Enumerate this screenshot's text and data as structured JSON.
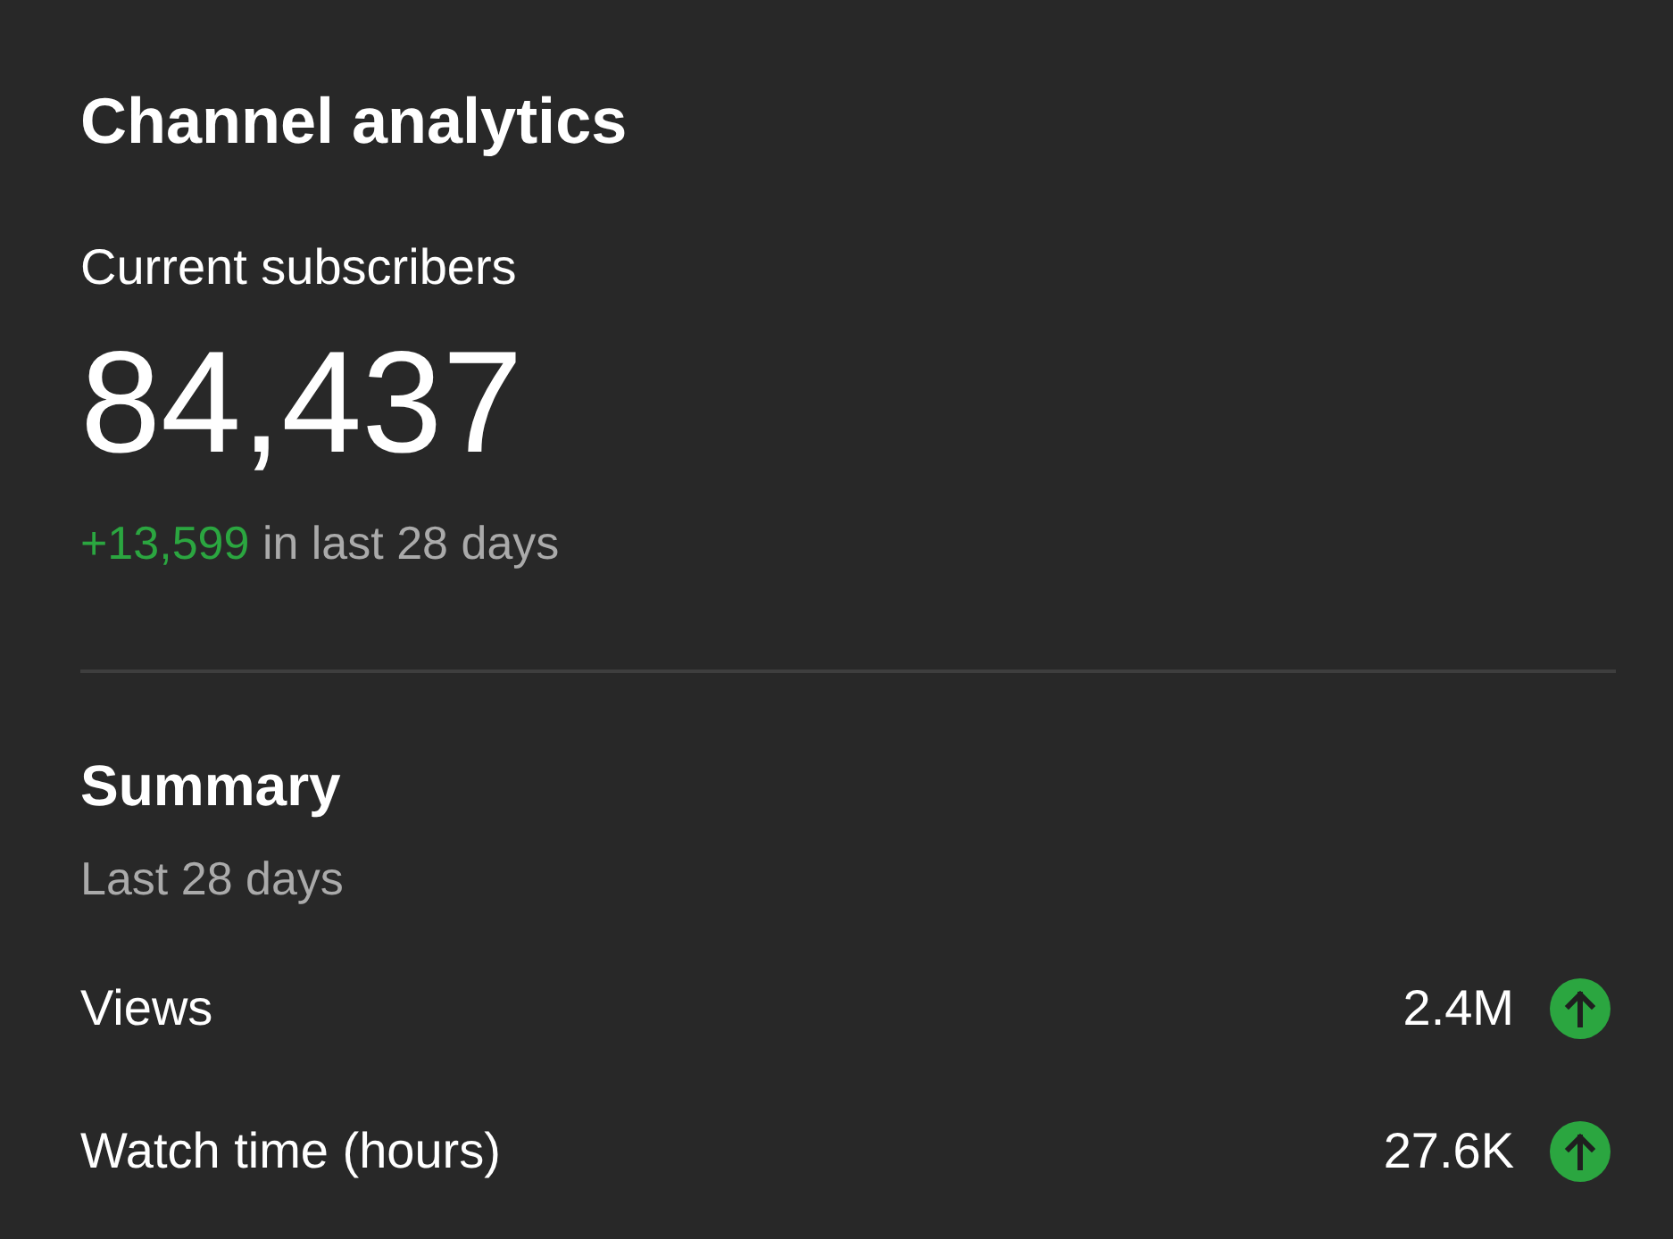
{
  "card": {
    "title": "Channel analytics"
  },
  "subscribers": {
    "label": "Current subscribers",
    "count": "84,437",
    "change": "+13,599",
    "change_suffix": "in last 28 days"
  },
  "summary": {
    "title": "Summary",
    "period": "Last 28 days",
    "metrics": [
      {
        "label": "Views",
        "value": "2.4M",
        "increased": true
      },
      {
        "label": "Watch time (hours)",
        "value": "27.6K",
        "increased": true
      }
    ]
  }
}
